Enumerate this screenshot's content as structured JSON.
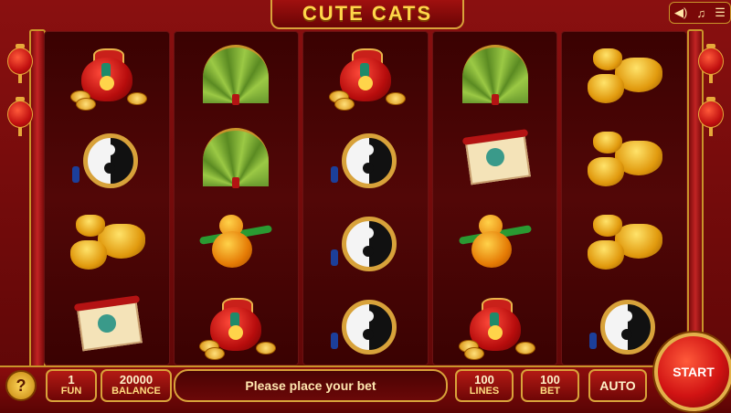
{
  "game": {
    "title": "CUTE CATS"
  },
  "audio_controls": {
    "volume_icon": "speaker-icon",
    "music_icon": "music-note-icon",
    "settings_icon": "sliders-icon"
  },
  "reels": [
    [
      "money-bag",
      "yin-yang-amulet",
      "gold-ingots",
      "scroll"
    ],
    [
      "folding-fan",
      "folding-fan",
      "gourd",
      "money-bag"
    ],
    [
      "money-bag",
      "yin-yang-amulet",
      "yin-yang-amulet",
      "yin-yang-amulet"
    ],
    [
      "folding-fan",
      "scroll",
      "gourd",
      "money-bag"
    ],
    [
      "gold-ingots",
      "gold-ingots",
      "gold-ingots",
      "yin-yang-amulet"
    ]
  ],
  "controls": {
    "help_label": "?",
    "fun": {
      "value": "1",
      "label": "FUN"
    },
    "balance": {
      "value": "20000",
      "label": "BALANCE"
    },
    "message": "Please place your bet",
    "lines": {
      "value": "100",
      "label": "LINES"
    },
    "bet": {
      "value": "100",
      "label": "BET"
    },
    "auto_label": "AUTO",
    "start_label": "START"
  },
  "colors": {
    "frame_gold": "#d9a33a",
    "accent_red": "#b31a14",
    "title_gold": "#ffd64a"
  }
}
